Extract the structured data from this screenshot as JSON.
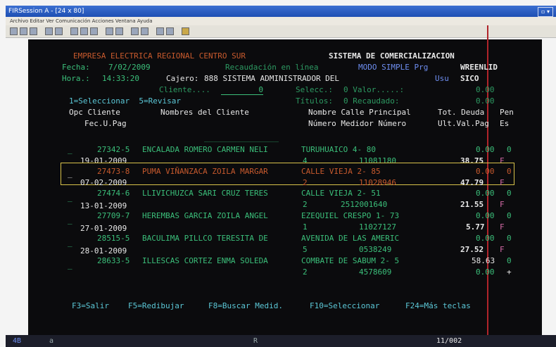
{
  "window": {
    "title": "FIRSession A - [24 x 80]",
    "button": "▫ ▾"
  },
  "menu": "Archivo  Editar  Ver  Comunicación  Acciones  Ventana  Ayuda",
  "header": {
    "company": "EMPRESA ELECTRICA REGIONAL CENTRO SUR",
    "system": "SISTEMA DE COMERCIALIZACION",
    "fecha_label": "Fecha:",
    "fecha_value": "7/02/2009",
    "recaudacion": "Recaudación en línea",
    "modo": "MODO SIMPLE Prg",
    "prg_value": "WREENLID",
    "hora_label": "Hora.:",
    "hora_value": "14:33:20",
    "cajero_label": "Cajero:",
    "cajero_value": "888 SISTEMA ADMINISTRADOR DEL",
    "usu_label": "Usu",
    "usu_value": "SICO",
    "cliente_label": "Cliente....",
    "cliente_value": "0",
    "selecc_label": "Selecc.:",
    "selecc_value": "0 Valor.....:",
    "selecc_amount": "0.00",
    "titulos_label": "Títulos:",
    "titulos_value": "0 Recaudado:",
    "titulos_amount": "0.00",
    "options": "1=Seleccionar  5=Revisar"
  },
  "columns": {
    "opc_cliente": "Opc Cliente",
    "fec_pag": "Fec.U.Pag",
    "nombres": "Nombres del Cliente",
    "calle": "Nombre Calle Principal",
    "numero_medidor": "Número Medidor Número",
    "tot_deuda": "Tot. Deuda",
    "ult_val_pag": "Ult.Val.Pag",
    "pen": "Pen",
    "es": "Es",
    "underline": "________________"
  },
  "rows": [
    {
      "opc": "_",
      "cliente": "27342-5",
      "nombre": "ENCALADA ROMERO CARMEN NELI",
      "calle": "TURUHUAICO 4- 80",
      "fecha": "19-01-2009",
      "numero": "4",
      "medidor": "11081180",
      "deuda": "0.00",
      "ultval": "38.75",
      "pen": "0",
      "es": "F"
    },
    {
      "opc": "_",
      "cliente": "27473-8",
      "nombre": "PUMA VIÑANZACA ZOILA MARGAR",
      "calle": "CALLE VIEJA 2- 85",
      "fecha": "07-02-2009",
      "numero": "2",
      "medidor": "11028946",
      "deuda": "0.00",
      "ultval": "47.79",
      "pen": "0",
      "es": "F"
    },
    {
      "opc": "_",
      "cliente": "27474-6",
      "nombre": "LLIVICHUZCA SARI CRUZ TERES",
      "calle": "CALLE VIEJA 2- 51",
      "fecha": "13-01-2009",
      "numero": "2",
      "medidor": "2512001640",
      "deuda": "0.00",
      "ultval": "21.55",
      "pen": "0",
      "es": "F"
    },
    {
      "opc": "_",
      "cliente": "27709-7",
      "nombre": "HEREMBAS GARCIA ZOILA ANGEL",
      "calle": "EZEQUIEL CRESPO 1- 73",
      "fecha": "27-01-2009",
      "numero": "1",
      "medidor": "11027127",
      "deuda": "0.00",
      "ultval": "5.77",
      "pen": "0",
      "es": "F"
    },
    {
      "opc": "_",
      "cliente": "28515-5",
      "nombre": "BACULIMA PILLCO TERESITA DE",
      "calle": "AVENIDA DE LAS AMERIC",
      "fecha": "28-01-2009",
      "numero": "5",
      "medidor": "0538249",
      "deuda": "0.00",
      "ultval": "27.52",
      "pen": "0",
      "es": "F"
    },
    {
      "opc": "_",
      "cliente": "28633-5",
      "nombre": "ILLESCAS CORTEZ ENMA SOLEDA",
      "calle": "COMBATE DE SABUM 2- 5",
      "fecha": "",
      "numero": "2",
      "medidor": "4578609",
      "deuda": "58.63",
      "ultval": "0.00",
      "pen": "0",
      "es": "+"
    }
  ],
  "fkeys": {
    "f3": "F3=Salir",
    "f5": "F5=Redibujar",
    "f8": "F8=Buscar Medid.",
    "f10": "F10=Seleccionar",
    "f24": "F24=Más teclas"
  },
  "status": {
    "left": "4B",
    "mode": "a",
    "mid": "R",
    "page": "11/002"
  }
}
